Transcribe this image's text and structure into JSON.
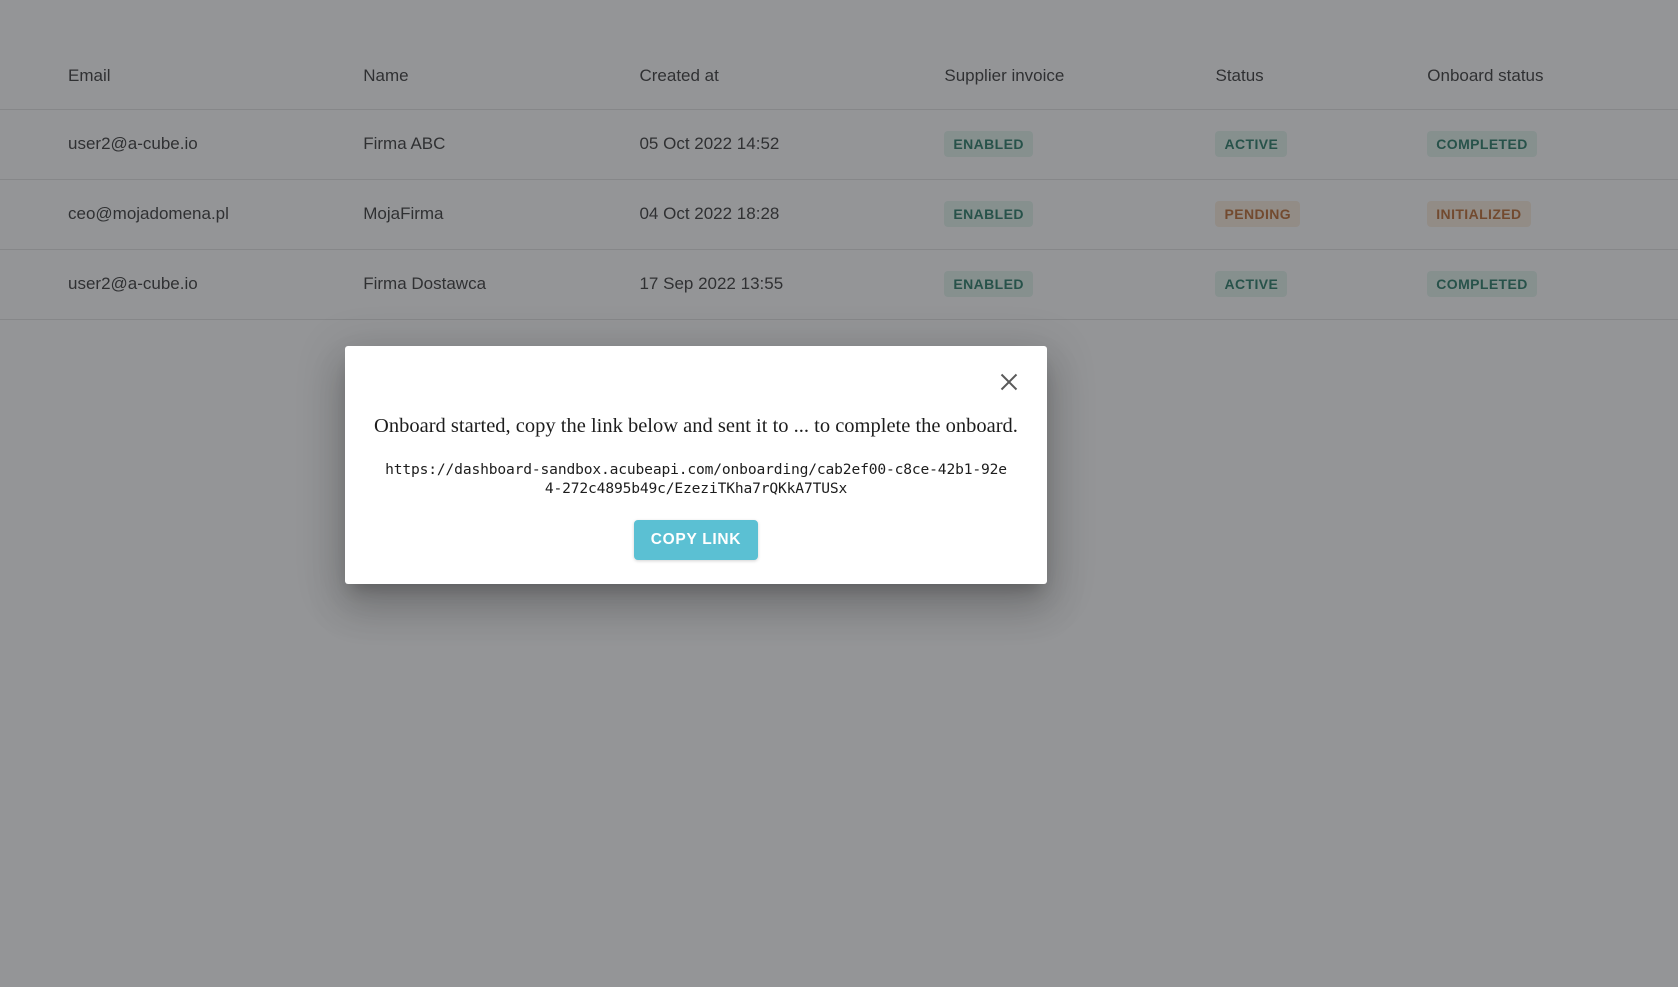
{
  "table": {
    "columns": [
      {
        "key": "email",
        "label": "Email"
      },
      {
        "key": "name",
        "label": "Name"
      },
      {
        "key": "created",
        "label": "Created at"
      },
      {
        "key": "supplier",
        "label": "Supplier invoice"
      },
      {
        "key": "status",
        "label": "Status"
      },
      {
        "key": "onboard",
        "label": "Onboard status"
      }
    ],
    "rows": [
      {
        "email": "user2@a-cube.io",
        "name": "Firma ABC",
        "created": "05 Oct 2022 14:52",
        "supplier": "ENABLED",
        "supplier_tone": "green",
        "status": "ACTIVE",
        "status_tone": "green",
        "onboard": "COMPLETED",
        "onboard_tone": "green"
      },
      {
        "email": "ceo@mojadomena.pl",
        "name": "MojaFirma",
        "created": "04 Oct 2022 18:28",
        "supplier": "ENABLED",
        "supplier_tone": "green",
        "status": "PENDING",
        "status_tone": "orange",
        "onboard": "INITIALIZED",
        "onboard_tone": "orange"
      },
      {
        "email": "user2@a-cube.io",
        "name": "Firma Dostawca",
        "created": "17 Sep 2022 13:55",
        "supplier": "ENABLED",
        "supplier_tone": "green",
        "status": "ACTIVE",
        "status_tone": "green",
        "onboard": "COMPLETED",
        "onboard_tone": "green"
      }
    ]
  },
  "modal": {
    "close_icon": "close-icon",
    "message": "Onboard started, copy the link below and sent it to ... to complete the onboard.",
    "link": "https://dashboard-sandbox.acubeapi.com/onboarding/cab2ef00-c8ce-42b1-92e4-272c4895b49c/EzeziTKha7rQKkA7TUSx",
    "copy_label": "COPY LINK"
  },
  "colors": {
    "accent": "#5bc0d3",
    "badge_green_text": "#0f6b54",
    "badge_green_bg": "#dff3ec",
    "badge_orange_text": "#b4591a",
    "badge_orange_bg": "#fbecd9",
    "overlay": "#3c3e42"
  }
}
